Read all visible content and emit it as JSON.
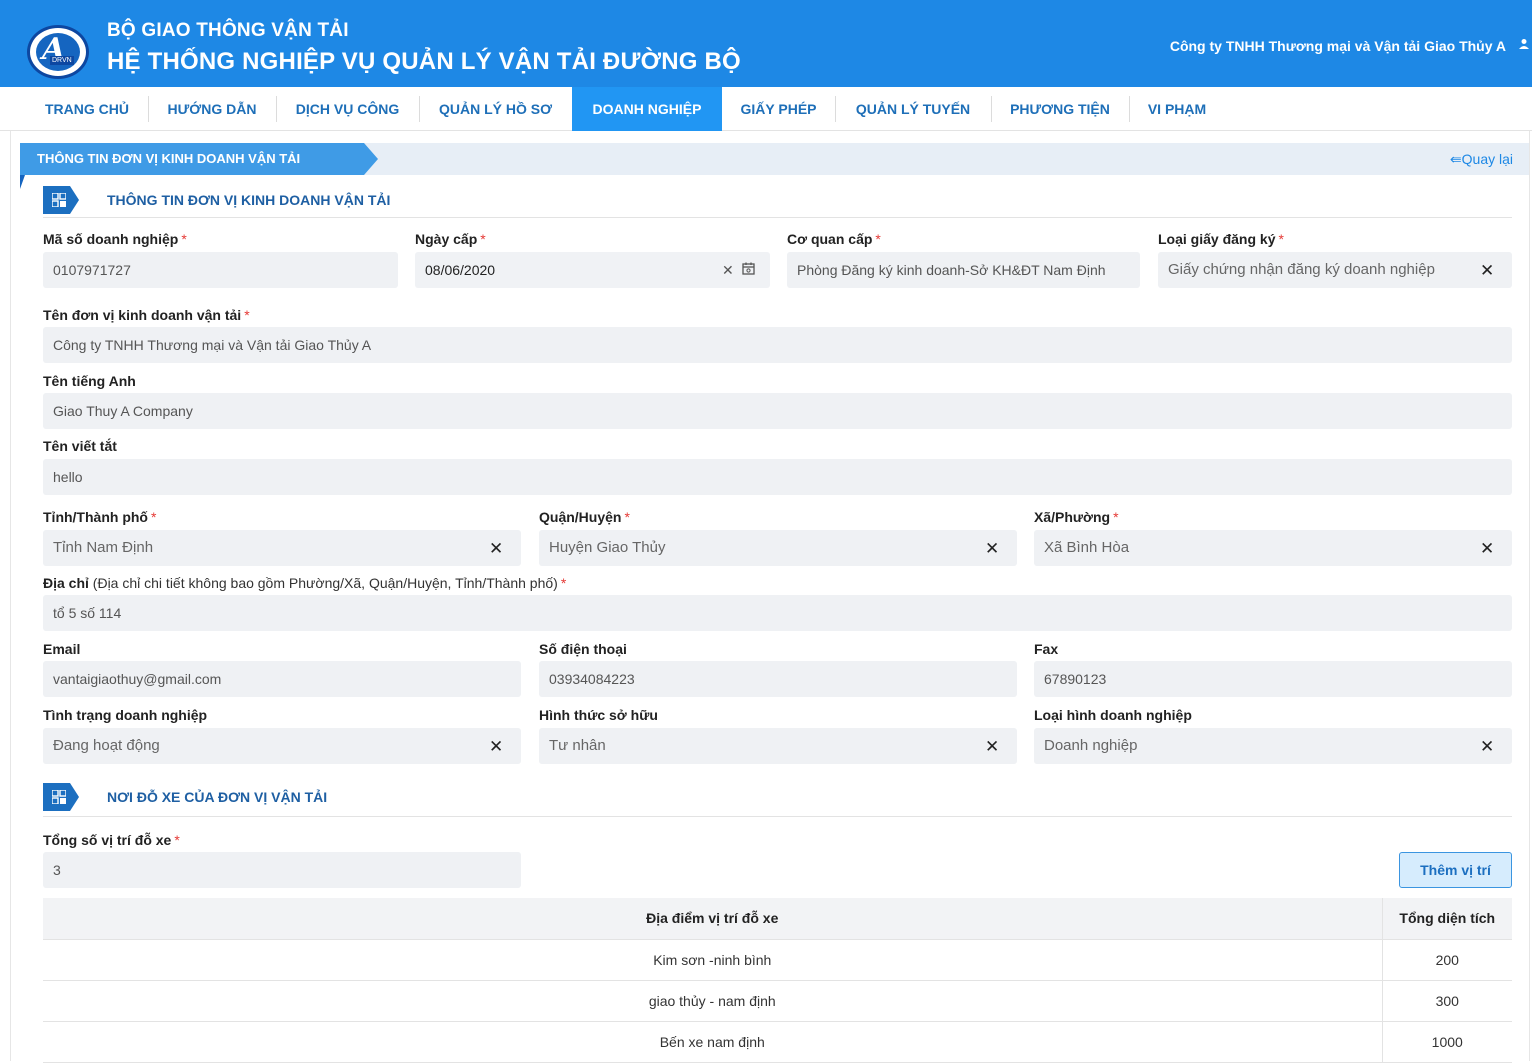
{
  "header": {
    "ministry": "BỘ GIAO THÔNG VẬN TẢI",
    "system": "HỆ THỐNG NGHIỆP VỤ QUẢN LÝ VẬN TẢI ĐƯỜNG BỘ",
    "logo_text": "DRVN",
    "user_name": "Công ty TNHH Thương mại và Vận tải Giao Thủy A",
    "user_icon": "person-icon"
  },
  "nav": {
    "items": [
      {
        "label": "TRANG CHỦ"
      },
      {
        "label": "HƯỚNG DẪN"
      },
      {
        "label": "DỊCH VỤ CÔNG"
      },
      {
        "label": "QUẢN LÝ HỒ SƠ"
      },
      {
        "label": "DOANH NGHIỆP"
      },
      {
        "label": "GIẤY PHÉP"
      },
      {
        "label": "QUẢN LÝ TUYẾN"
      },
      {
        "label": "PHƯƠNG TIỆN"
      },
      {
        "label": "VI PHẠM"
      }
    ],
    "active": "DOANH NGHIỆP"
  },
  "page": {
    "title": "THÔNG TIN ĐƠN VỊ KINH DOANH VẬN TẢI",
    "back_link": "⇚Quay lại"
  },
  "section_info": {
    "title": "THÔNG TIN ĐƠN VỊ KINH DOANH VẬN TẢI"
  },
  "form": {
    "tax_code": {
      "label": "Mã số doanh nghiệp",
      "value": "0107971727"
    },
    "issue_date": {
      "label": "Ngày cấp",
      "value": "08/06/2020"
    },
    "issuing_agency": {
      "label": "Cơ quan cấp",
      "value": "Phòng Đăng ký kinh doanh-Sở KH&ĐT Nam Định"
    },
    "registration_type": {
      "label": "Loại giấy đăng ký",
      "value": "Giấy chứng nhận đăng ký doanh nghiệp"
    },
    "company_name": {
      "label": "Tên đơn vị kinh doanh vận tải",
      "value": "Công ty TNHH Thương mại và Vận tải Giao Thủy A"
    },
    "english_name": {
      "label": "Tên tiếng Anh",
      "value": "Giao Thuy A Company"
    },
    "short_name": {
      "label": "Tên viết tắt",
      "value": "hello"
    },
    "province": {
      "label": "Tỉnh/Thành phố",
      "value": "Tỉnh Nam Định"
    },
    "district": {
      "label": "Quận/Huyện",
      "value": "Huyện Giao Thủy"
    },
    "ward": {
      "label": "Xã/Phường",
      "value": "Xã Bình Hòa"
    },
    "address": {
      "label": "Địa chỉ",
      "hint": "(Địa chỉ chi tiết không bao gồm Phường/Xã, Quận/Huyện, Tỉnh/Thành phố)",
      "value": "tổ 5 số 114"
    },
    "email": {
      "label": "Email",
      "value": "vantaigiaothuy@gmail.com"
    },
    "phone": {
      "label": "Số điện thoại",
      "value": "03934084223"
    },
    "fax": {
      "label": "Fax",
      "value": "67890123"
    },
    "status": {
      "label": "Tình trạng doanh nghiệp",
      "value": "Đang hoạt động"
    },
    "ownership": {
      "label": "Hình thức sở hữu",
      "value": "Tư nhân"
    },
    "business_type": {
      "label": "Loại hình doanh nghiệp",
      "value": "Doanh nghiệp"
    },
    "required_mark": "*",
    "clear_symbol": "✕"
  },
  "section_parking": {
    "title": "NƠI ĐỖ XE CỦA ĐƠN VỊ VẬN TẢI",
    "total_label": "Tổng số vị trí đỗ xe",
    "total_value": "3",
    "add_button": "Thêm vị trí",
    "table": {
      "headers": [
        "Địa điểm vị trí đỗ xe",
        "Tổng diện tích"
      ],
      "rows": [
        [
          "Kim sơn -ninh bình",
          "200"
        ],
        [
          "giao thủy - nam định",
          "300"
        ],
        [
          "Bến xe nam định",
          "1000"
        ]
      ]
    }
  },
  "colors": {
    "header_bg": "#1e88e5",
    "nav_active": "#2196f3",
    "accent": "#1c6fc0",
    "required": "#e53935",
    "field_bg": "#eff1f4"
  }
}
